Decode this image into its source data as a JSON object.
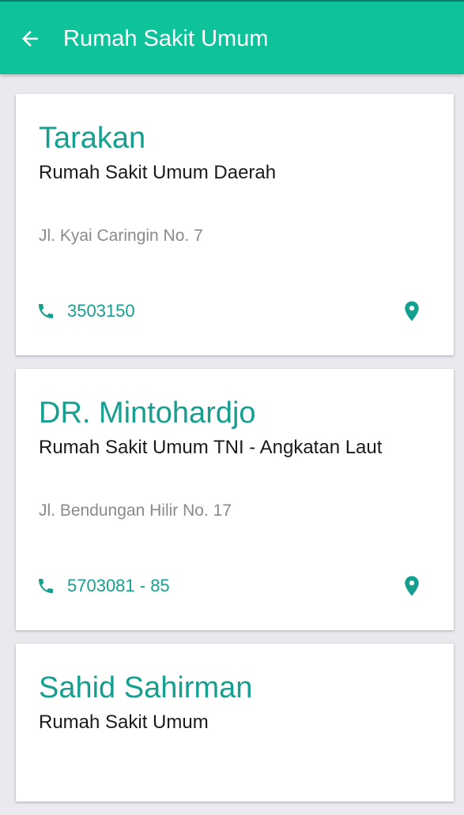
{
  "appbar": {
    "title": "Rumah Sakit Umum",
    "back_icon": "arrow-back-icon",
    "color": "#0ec399"
  },
  "colors": {
    "accent": "#159f8f",
    "background": "#e9e9ee"
  },
  "hospitals": [
    {
      "name": "Tarakan",
      "type": "Rumah Sakit Umum Daerah",
      "address": "Jl. Kyai Caringin No. 7",
      "phone": "3503150",
      "phone_icon": "phone-icon",
      "map_icon": "map-pin-icon"
    },
    {
      "name": "DR. Mintohardjo",
      "type": "Rumah Sakit Umum TNI - Angkatan Laut",
      "address": "Jl. Bendungan Hilir No. 17",
      "phone": "5703081 - 85",
      "phone_icon": "phone-icon",
      "map_icon": "map-pin-icon"
    },
    {
      "name": "Sahid Sahirman",
      "type": "Rumah Sakit Umum"
    }
  ]
}
